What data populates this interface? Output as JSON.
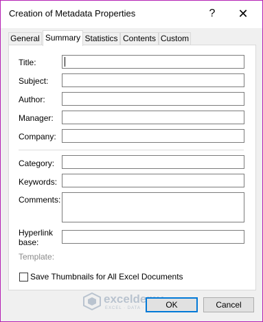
{
  "window": {
    "title": "Creation of Metadata Properties",
    "help_label": "?",
    "close_label": "✕"
  },
  "tabs": [
    {
      "label": "General"
    },
    {
      "label": "Summary",
      "active": true
    },
    {
      "label": "Statistics"
    },
    {
      "label": "Contents"
    },
    {
      "label": "Custom"
    }
  ],
  "fields": {
    "title": {
      "label": "Title:",
      "value": ""
    },
    "subject": {
      "label": "Subject:",
      "value": ""
    },
    "author": {
      "label": "Author:",
      "value": ""
    },
    "manager": {
      "label": "Manager:",
      "value": ""
    },
    "company": {
      "label": "Company:",
      "value": ""
    },
    "category": {
      "label": "Category:",
      "value": ""
    },
    "keywords": {
      "label": "Keywords:",
      "value": ""
    },
    "comments": {
      "label": "Comments:",
      "value": ""
    },
    "hyperlink": {
      "label_line1": "Hyperlink",
      "label_line2": "base:",
      "value": ""
    },
    "template": {
      "label": "Template:"
    }
  },
  "thumbnails": {
    "label": "Save Thumbnails for All Excel Documents",
    "checked": false
  },
  "buttons": {
    "ok": "OK",
    "cancel": "Cancel"
  },
  "watermark": {
    "brand": "exceldemy",
    "tagline": "EXCEL · DATA · BI",
    "color": "#b9c3cf"
  }
}
